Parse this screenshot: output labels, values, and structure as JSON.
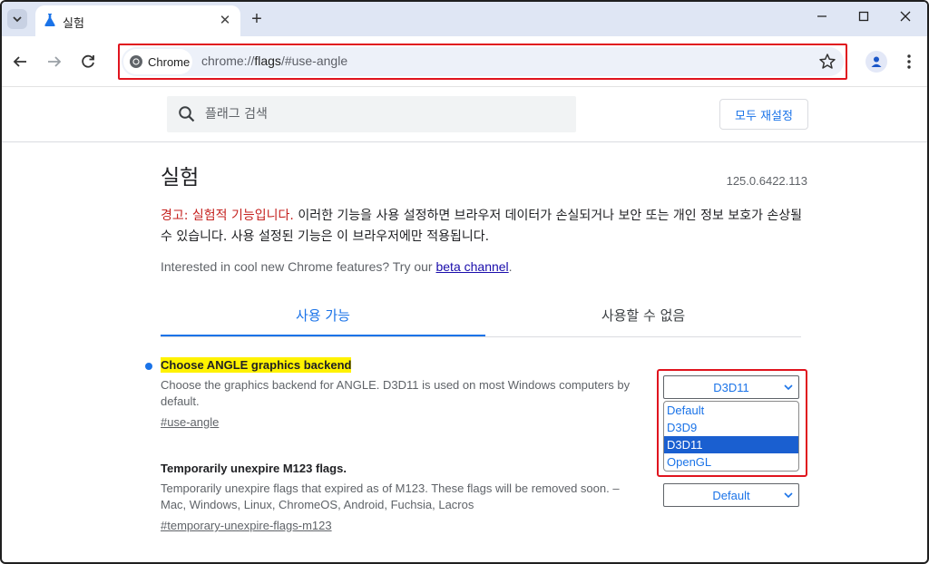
{
  "tab": {
    "title": "실험"
  },
  "toolbar": {
    "chip_label": "Chrome",
    "url_prefix": "chrome://",
    "url_highlight": "flags",
    "url_suffix": "/#use-angle"
  },
  "header": {
    "search_placeholder": "플래그 검색",
    "reset_all_label": "모두 재설정"
  },
  "main": {
    "title": "실험",
    "version": "125.0.6422.113",
    "warning_prefix": "경고: 실험적 기능입니다.",
    "warning_text": " 이러한 기능을 사용 설정하면 브라우저 데이터가 손실되거나 보안 또는 개인 정보 보호가 손상될 수 있습니다. 사용 설정된 기능은 이 브라우저에만 적용됩니다.",
    "promo_text": "Interested in cool new Chrome features? Try our ",
    "promo_link": "beta channel",
    "promo_end": ".",
    "tabs": [
      {
        "label": "사용 가능"
      },
      {
        "label": "사용할 수 없음"
      }
    ]
  },
  "flags": [
    {
      "name": "Choose ANGLE graphics backend",
      "description": "Choose the graphics backend for ANGLE. D3D11 is used on most Windows computers by default.",
      "anchor": "#use-angle",
      "selected": "D3D11",
      "options": [
        "Default",
        "D3D9",
        "D3D11",
        "OpenGL"
      ]
    },
    {
      "name": "Temporarily unexpire M123 flags.",
      "description": "Temporarily unexpire flags that expired as of M123. These flags will be removed soon. – Mac, Windows, Linux, ChromeOS, Android, Fuchsia, Lacros",
      "anchor": "#temporary-unexpire-flags-m123",
      "selected": "Default"
    }
  ],
  "colors": {
    "accent": "#1a73e8",
    "warning": "#c5221f",
    "highlight_box": "#e0141e",
    "flag_highlight": "#fff200",
    "tabstrip": "#dfe6f4"
  },
  "icons": [
    "tab-search-icon",
    "flask-icon",
    "close-icon",
    "plus-icon",
    "minimize-icon",
    "maximize-icon",
    "window-close-icon",
    "back-arrow-icon",
    "forward-arrow-icon",
    "reload-icon",
    "chrome-logo-icon",
    "star-icon",
    "profile-icon",
    "kebab-menu-icon",
    "search-icon",
    "chevron-down-icon"
  ]
}
